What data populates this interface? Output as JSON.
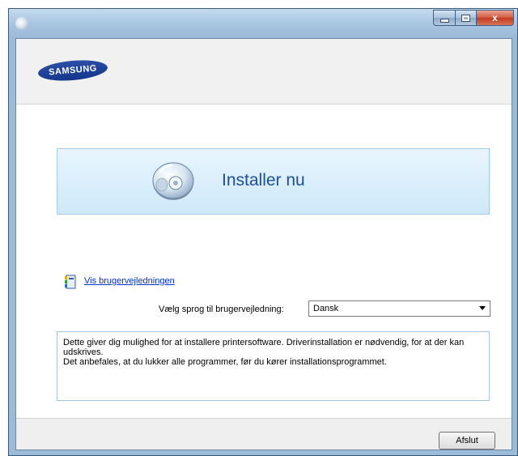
{
  "window": {
    "caption_buttons": {
      "minimize": "minimize",
      "maximize": "maximize",
      "close": "x"
    }
  },
  "header": {
    "logo_text": "SAMSUNG",
    "logo_color": "#1e3f98"
  },
  "install": {
    "label": "Installer nu",
    "icon": "cd-disc-icon"
  },
  "guide": {
    "link_text": "Vis brugervejledningen",
    "icon": "user-guide-icon"
  },
  "language": {
    "label": "Vælg sprog til brugervejledning:",
    "selected": "Dansk"
  },
  "description": {
    "line1": "Dette giver dig mulighed for at installere printersoftware. Driverinstallation er nødvendig, for at der kan udskrives.",
    "line2": "Det anbefales, at du lukker alle programmer, før du kører installationsprogrammet."
  },
  "footer": {
    "exit_label": "Afslut"
  }
}
